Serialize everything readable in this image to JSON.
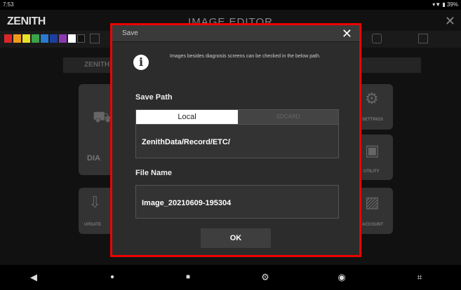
{
  "status_bar": {
    "time": "7:53",
    "right": "▾▼ ▮ 39%"
  },
  "app": {
    "logo": "ZENITH",
    "title": "IMAGE EDITOR",
    "close_icon": "close-icon"
  },
  "toolbar": {
    "palette": [
      "#d9262a",
      "#f09a1a",
      "#e8e02a",
      "#3aa34a",
      "#2a7ad0",
      "#1e3f9e",
      "#8a3ab0",
      "#ffffff",
      "#111111"
    ]
  },
  "background": {
    "header_label": "ZENITH",
    "tile_labels": [
      "DIA",
      "SETTINGS",
      "UTILITY",
      "UPDATE",
      "ACCOUNT"
    ]
  },
  "dialog": {
    "title": "Save",
    "info_text": "Images besides diagnosis screens can be checked in the below path.",
    "save_path_label": "Save Path",
    "tabs": [
      {
        "label": "Local",
        "active": true
      },
      {
        "label": "SDCARD",
        "active": false
      }
    ],
    "save_path_value": "ZenithData/Record/ETC/",
    "file_name_label": "File Name",
    "file_name_value": "Image_20210609-195304",
    "ok_label": "OK",
    "frame_color": "#ee0000"
  },
  "navbar": {
    "buttons": [
      "back-icon",
      "home-dot-icon",
      "recents-icon",
      "settings-icon",
      "camera-icon",
      "screenshot-icon"
    ]
  }
}
